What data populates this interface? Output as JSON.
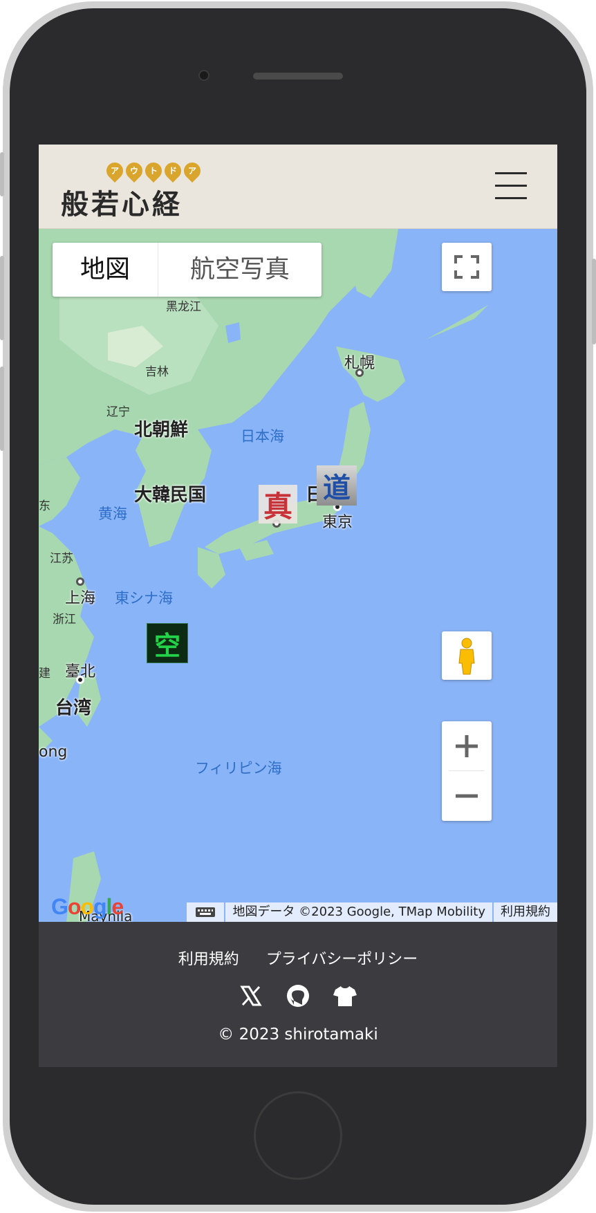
{
  "header": {
    "logo_text": "般若心経",
    "logo_ruby": [
      "ア",
      "ウ",
      "ト",
      "ド",
      "ア"
    ]
  },
  "map": {
    "maptype": {
      "map_label": "地図",
      "satellite_label": "航空写真"
    },
    "labels": {
      "heilongjiang": "黑龙江",
      "jilin": "吉林",
      "liaoning": "辽宁",
      "north_korea": "北朝鮮",
      "south_korea": "大韓民国",
      "sea_of_japan": "日本海",
      "yellow_sea": "黄海",
      "east_china_sea": "東シナ海",
      "philippine_sea": "フィリピン海",
      "sapporo": "札幌",
      "tokyo": "東京",
      "japan_partial": "日",
      "shanghai": "上海",
      "jiangsu": "江苏",
      "zhejiang": "浙江",
      "taipei": "臺北",
      "taiwan": "台湾",
      "shandong_partial": "东",
      "hongkong_partial": "ong",
      "manila_partial": "Maynila",
      "fujian_partial": "建"
    },
    "markers": {
      "shin": "真",
      "do": "道",
      "ku": "空"
    },
    "attribution": {
      "map_data": "地図データ ©2023 Google, TMap Mobility",
      "terms": "利用規約"
    },
    "google_logo": "Google"
  },
  "footer": {
    "terms_link": "利用規約",
    "privacy_link": "プライバシーポリシー",
    "copyright": "© 2023 shirotamaki"
  }
}
